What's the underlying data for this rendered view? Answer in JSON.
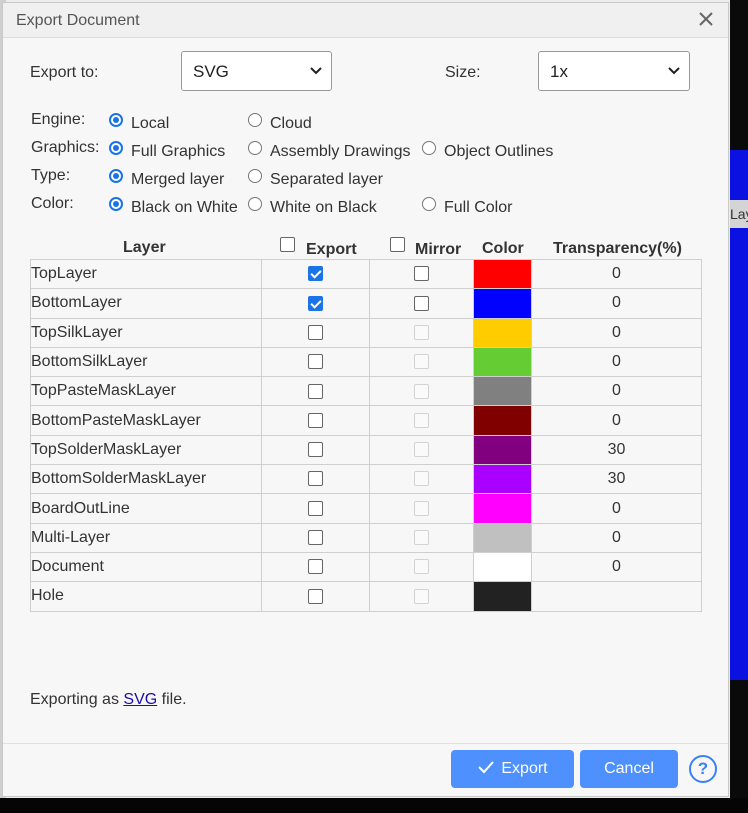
{
  "dialog": {
    "title": "Export Document"
  },
  "options": {
    "export_to_label": "Export to:",
    "export_to_value": "SVG",
    "size_label": "Size:",
    "size_value": "1x"
  },
  "rows": [
    {
      "label": "Engine:",
      "options": [
        {
          "text": "Local",
          "checked": true
        },
        {
          "text": "Cloud",
          "checked": false
        }
      ]
    },
    {
      "label": "Graphics:",
      "options": [
        {
          "text": "Full Graphics",
          "checked": true
        },
        {
          "text": "Assembly Drawings",
          "checked": false
        },
        {
          "text": "Object Outlines",
          "checked": false
        }
      ]
    },
    {
      "label": "Type:",
      "options": [
        {
          "text": "Merged layer",
          "checked": true
        },
        {
          "text": "Separated layer",
          "checked": false
        }
      ]
    },
    {
      "label": "Color:",
      "options": [
        {
          "text": "Black on White",
          "checked": true
        },
        {
          "text": "White on Black",
          "checked": false
        },
        {
          "text": "Full Color",
          "checked": false
        }
      ]
    }
  ],
  "table": {
    "headers": {
      "layer": "Layer",
      "export": "Export",
      "mirror": "Mirror",
      "color": "Color",
      "transparency": "Transparency(%)"
    },
    "layers": [
      {
        "name": "TopLayer",
        "export": true,
        "mirror_enabled": true,
        "color": "#ff0000",
        "transparency": "0"
      },
      {
        "name": "BottomLayer",
        "export": true,
        "mirror_enabled": true,
        "color": "#0000ff",
        "transparency": "0"
      },
      {
        "name": "TopSilkLayer",
        "export": false,
        "mirror_enabled": false,
        "color": "#ffcc00",
        "transparency": "0"
      },
      {
        "name": "BottomSilkLayer",
        "export": false,
        "mirror_enabled": false,
        "color": "#66cc33",
        "transparency": "0"
      },
      {
        "name": "TopPasteMaskLayer",
        "export": false,
        "mirror_enabled": false,
        "color": "#808080",
        "transparency": "0"
      },
      {
        "name": "BottomPasteMaskLayer",
        "export": false,
        "mirror_enabled": false,
        "color": "#800000",
        "transparency": "0"
      },
      {
        "name": "TopSolderMaskLayer",
        "export": false,
        "mirror_enabled": false,
        "color": "#800080",
        "transparency": "30"
      },
      {
        "name": "BottomSolderMaskLayer",
        "export": false,
        "mirror_enabled": false,
        "color": "#aa00ff",
        "transparency": "30"
      },
      {
        "name": "BoardOutLine",
        "export": false,
        "mirror_enabled": false,
        "color": "#ff00ff",
        "transparency": "0"
      },
      {
        "name": "Multi-Layer",
        "export": false,
        "mirror_enabled": false,
        "color": "#c0c0c0",
        "transparency": "0"
      },
      {
        "name": "Document",
        "export": false,
        "mirror_enabled": false,
        "color": "#ffffff",
        "transparency": "0"
      },
      {
        "name": "Hole",
        "export": false,
        "mirror_enabled": false,
        "color": "#222222",
        "transparency": ""
      }
    ]
  },
  "footer": {
    "prefix": "Exporting as",
    "link": "SVG",
    "suffix": "file.",
    "export_button": "Export",
    "cancel_button": "Cancel",
    "help": "?"
  },
  "background": {
    "tab_text": "Lay"
  }
}
